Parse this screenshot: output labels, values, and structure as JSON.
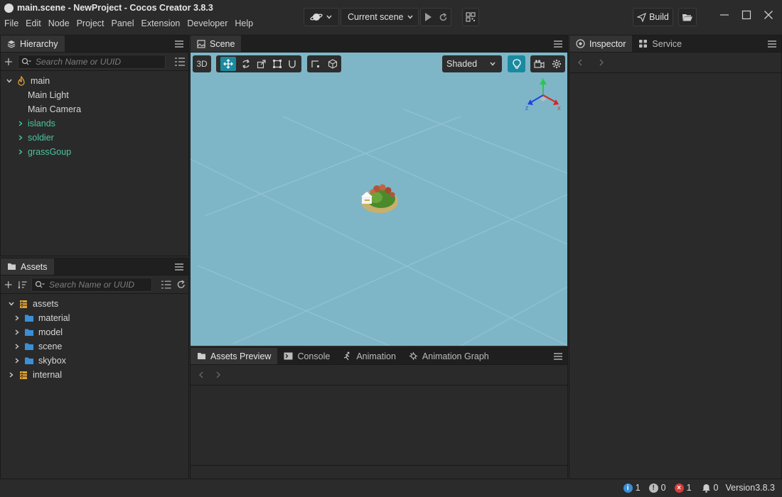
{
  "window": {
    "title": "main.scene - NewProject - Cocos Creator 3.8.3"
  },
  "menu": [
    "File",
    "Edit",
    "Node",
    "Project",
    "Panel",
    "Extension",
    "Developer",
    "Help"
  ],
  "toolbar": {
    "scene_select": "Current scene",
    "build_label": "Build"
  },
  "hierarchy": {
    "tab": "Hierarchy",
    "search_placeholder": "Search Name or UUID",
    "root": "main",
    "nodes": [
      {
        "label": "Main Light",
        "prefab": false,
        "expandable": false
      },
      {
        "label": "Main Camera",
        "prefab": false,
        "expandable": false
      },
      {
        "label": "islands",
        "prefab": true,
        "expandable": true
      },
      {
        "label": "soldier",
        "prefab": true,
        "expandable": true
      },
      {
        "label": "grassGoup",
        "prefab": true,
        "expandable": true
      }
    ]
  },
  "assets": {
    "tab": "Assets",
    "search_placeholder": "Search Name or UUID",
    "root": "assets",
    "folders": [
      "material",
      "model",
      "scene",
      "skybox"
    ],
    "internal": "internal"
  },
  "scene": {
    "tab": "Scene",
    "mode_label": "3D",
    "shading": "Shaded",
    "gizmo_axes": [
      "X",
      "Y",
      "Z"
    ],
    "colors": {
      "background": "#7eb6c8",
      "accent": "#1b8aa0"
    }
  },
  "preview": {
    "tabs": [
      "Assets Preview",
      "Console",
      "Animation",
      "Animation Graph"
    ]
  },
  "inspector": {
    "tabs": [
      "Inspector",
      "Service"
    ]
  },
  "status": {
    "info_count": "1",
    "warn_count": "0",
    "error_count": "1",
    "notify_count": "0",
    "version": "Version3.8.3"
  }
}
